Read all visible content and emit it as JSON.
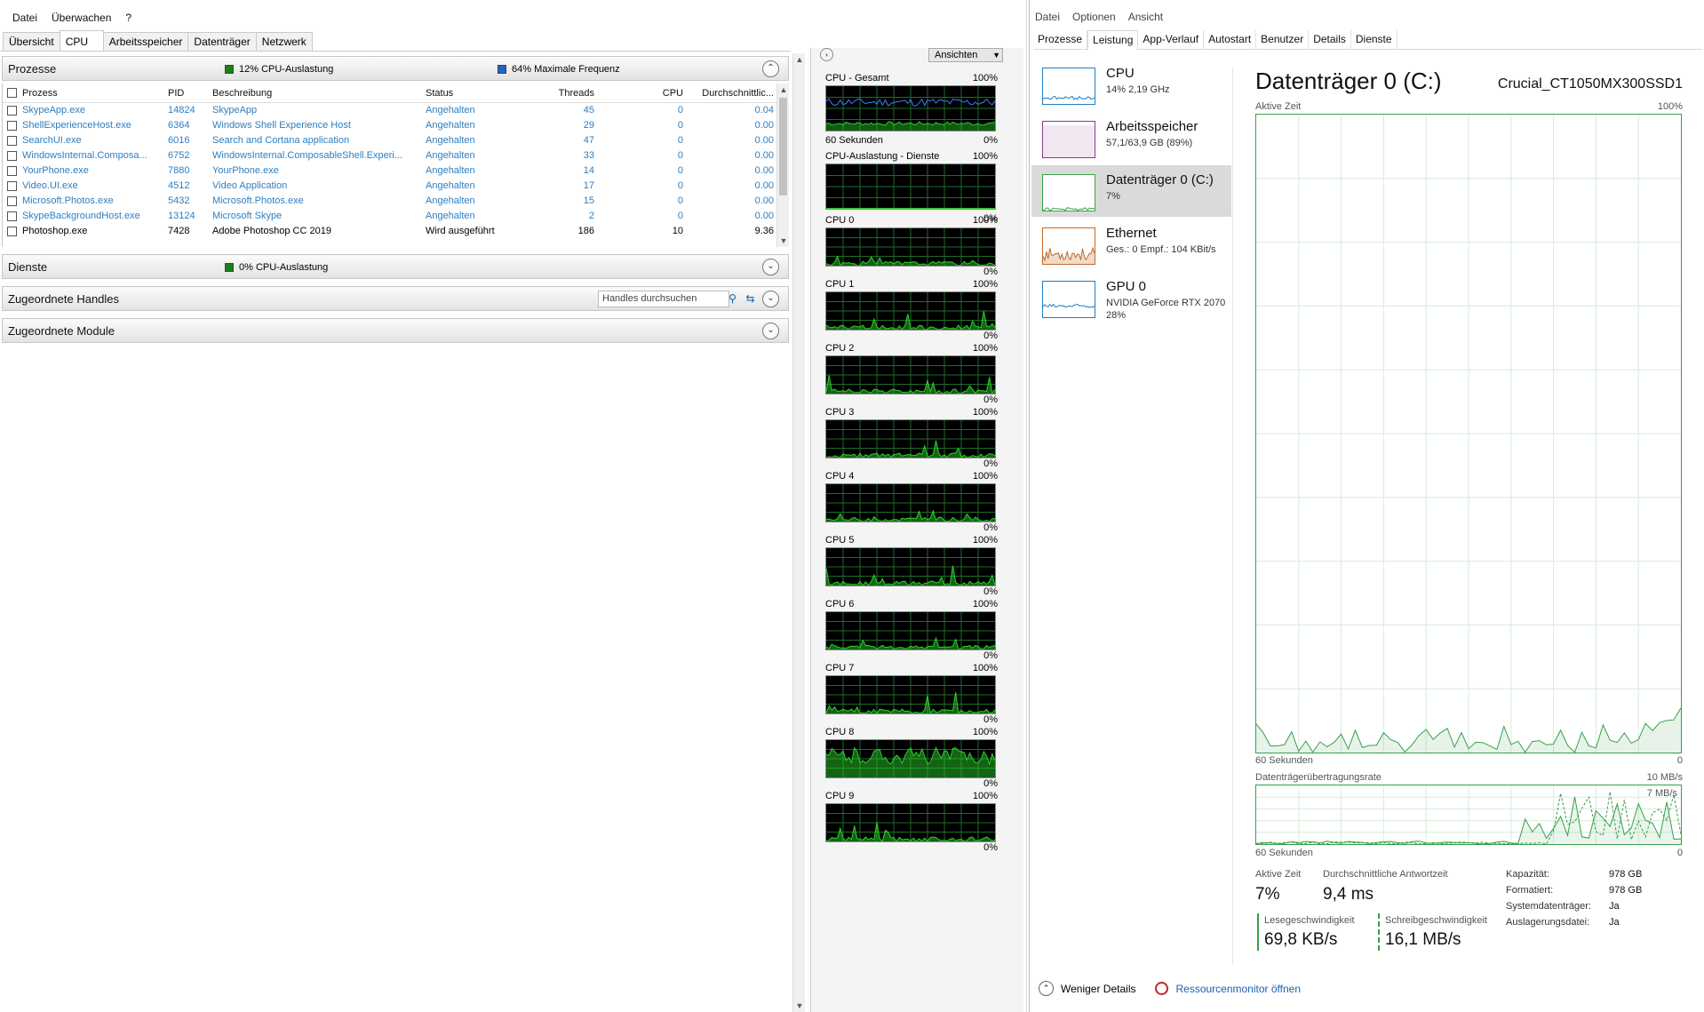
{
  "resmon": {
    "menu": [
      "Datei",
      "Überwachen",
      "?"
    ],
    "tabs": [
      "Übersicht",
      "CPU",
      "Arbeitsspeicher",
      "Datenträger",
      "Netzwerk"
    ],
    "active_tab": 1,
    "processes_section": {
      "title": "Prozesse",
      "legend1": "12% CPU-Auslastung",
      "legend1_color": "#1a7f1a",
      "legend2": "64% Maximale Frequenz",
      "legend2_color": "#1f64c8",
      "columns": [
        "Prozess",
        "PID",
        "Beschreibung",
        "Status",
        "Threads",
        "CPU",
        "Durchschnittlic..."
      ],
      "rows": [
        {
          "name": "SkypeApp.exe",
          "pid": "14824",
          "desc": "SkypeApp",
          "status": "Angehalten",
          "threads": "45",
          "cpu": "0",
          "avg": "0.04",
          "suspended": true
        },
        {
          "name": "ShellExperienceHost.exe",
          "pid": "6364",
          "desc": "Windows Shell Experience Host",
          "status": "Angehalten",
          "threads": "29",
          "cpu": "0",
          "avg": "0.00",
          "suspended": true
        },
        {
          "name": "SearchUI.exe",
          "pid": "6016",
          "desc": "Search and Cortana application",
          "status": "Angehalten",
          "threads": "47",
          "cpu": "0",
          "avg": "0.00",
          "suspended": true
        },
        {
          "name": "WindowsInternal.Composa...",
          "pid": "6752",
          "desc": "WindowsInternal.ComposableShell.Experi...",
          "status": "Angehalten",
          "threads": "33",
          "cpu": "0",
          "avg": "0.00",
          "suspended": true
        },
        {
          "name": "YourPhone.exe",
          "pid": "7880",
          "desc": "YourPhone.exe",
          "status": "Angehalten",
          "threads": "14",
          "cpu": "0",
          "avg": "0.00",
          "suspended": true
        },
        {
          "name": "Video.UI.exe",
          "pid": "4512",
          "desc": "Video Application",
          "status": "Angehalten",
          "threads": "17",
          "cpu": "0",
          "avg": "0.00",
          "suspended": true
        },
        {
          "name": "Microsoft.Photos.exe",
          "pid": "5432",
          "desc": "Microsoft.Photos.exe",
          "status": "Angehalten",
          "threads": "15",
          "cpu": "0",
          "avg": "0.00",
          "suspended": true
        },
        {
          "name": "SkypeBackgroundHost.exe",
          "pid": "13124",
          "desc": "Microsoft Skype",
          "status": "Angehalten",
          "threads": "2",
          "cpu": "0",
          "avg": "0.00",
          "suspended": true
        },
        {
          "name": "Photoshop.exe",
          "pid": "7428",
          "desc": "Adobe Photoshop CC 2019",
          "status": "Wird ausgeführt",
          "threads": "186",
          "cpu": "10",
          "avg": "9.36",
          "suspended": false
        }
      ]
    },
    "services_section": {
      "title": "Dienste",
      "legend": "0% CPU-Auslastung",
      "legend_color": "#1a7f1a"
    },
    "handles_section": {
      "title": "Zugeordnete Handles",
      "search_placeholder": "Handles durchsuchen"
    },
    "modules_section": {
      "title": "Zugeordnete Module"
    },
    "graphs": {
      "views_label": "Ansichten",
      "cpu_total": {
        "title": "CPU - Gesamt",
        "max": "100%",
        "min": "0%",
        "time": "60 Sekunden"
      },
      "cpu_services": {
        "title": "CPU-Auslastung - Dienste",
        "max": "100%",
        "min": "0%"
      },
      "cores": [
        {
          "title": "CPU 0",
          "max": "100%",
          "min": "0%"
        },
        {
          "title": "CPU 1",
          "max": "100%",
          "min": "0%"
        },
        {
          "title": "CPU 2",
          "max": "100%",
          "min": "0%"
        },
        {
          "title": "CPU 3",
          "max": "100%",
          "min": "0%"
        },
        {
          "title": "CPU 4",
          "max": "100%",
          "min": "0%"
        },
        {
          "title": "CPU 5",
          "max": "100%",
          "min": "0%"
        },
        {
          "title": "CPU 6",
          "max": "100%",
          "min": "0%"
        },
        {
          "title": "CPU 7",
          "max": "100%",
          "min": "0%"
        },
        {
          "title": "CPU 8",
          "max": "100%",
          "min": "0%"
        },
        {
          "title": "CPU 9",
          "max": "100%",
          "min": "0%"
        }
      ]
    }
  },
  "taskmgr": {
    "menu": [
      "Datei",
      "Optionen",
      "Ansicht"
    ],
    "tabs": [
      "Prozesse",
      "Leistung",
      "App-Verlauf",
      "Autostart",
      "Benutzer",
      "Details",
      "Dienste"
    ],
    "active_tab": 1,
    "sidebar": [
      {
        "name": "CPU",
        "sub": "14% 2,19 GHz",
        "color": "#1f7dc1"
      },
      {
        "name": "Arbeitsspeicher",
        "sub": "57,1/63,9 GB (89%)",
        "color": "#8b3a8f"
      },
      {
        "name": "Datenträger 0 (C:)",
        "sub": "7%",
        "color": "#3aa34a"
      },
      {
        "name": "Ethernet",
        "sub": "Ges.: 0 Empf.: 104 KBit/s",
        "color": "#c26a28"
      },
      {
        "name": "GPU 0",
        "sub": "NVIDIA GeForce RTX 2070\n28%",
        "color": "#1f7dc1"
      }
    ],
    "detail": {
      "title": "Datenträger 0 (C:)",
      "model": "Crucial_CT1050MX300SSD1",
      "chart1_label": "Aktive Zeit",
      "chart1_max": "100%",
      "chart1_time": "60 Sekunden",
      "chart1_min": "0",
      "chart2_label": "Datenträgerübertragungsrate",
      "chart2_max": "10 MB/s",
      "chart2_marker": "7 MB/s",
      "chart2_time": "60 Sekunden",
      "chart2_min": "0",
      "stats": {
        "active_label": "Aktive Zeit",
        "active_value": "7%",
        "resp_label": "Durchschnittliche Antwortzeit",
        "resp_value": "9,4 ms",
        "read_label": "Lesegeschwindigkeit",
        "read_value": "69,8 KB/s",
        "write_label": "Schreibgeschwindigkeit",
        "write_value": "16,1 MB/s"
      },
      "props": [
        {
          "k": "Kapazität:",
          "v": "978 GB"
        },
        {
          "k": "Formatiert:",
          "v": "978 GB"
        },
        {
          "k": "Systemdatenträger:",
          "v": "Ja"
        },
        {
          "k": "Auslagerungsdatei:",
          "v": "Ja"
        }
      ],
      "accent": "#36a04a"
    },
    "footer": {
      "less_details": "Weniger Details",
      "open_resmon": "Ressourcenmonitor öffnen"
    }
  }
}
